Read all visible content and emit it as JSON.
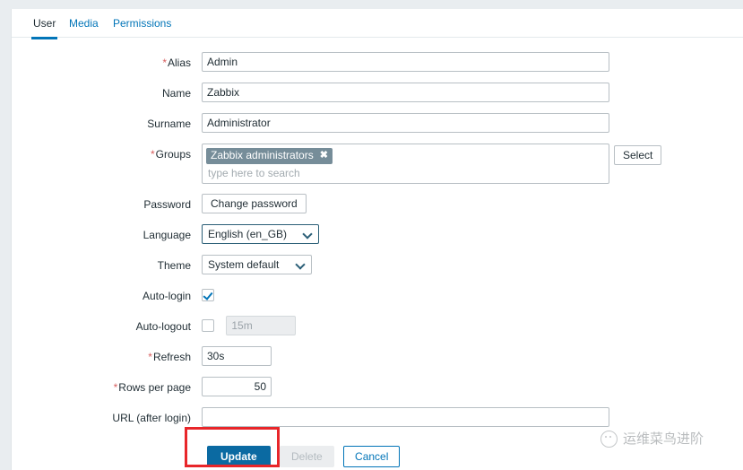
{
  "tabs": [
    {
      "label": "User",
      "active": true
    },
    {
      "label": "Media",
      "active": false
    },
    {
      "label": "Permissions",
      "active": false
    }
  ],
  "form": {
    "alias": {
      "label": "Alias",
      "required": true,
      "value": "Admin"
    },
    "name": {
      "label": "Name",
      "required": false,
      "value": "Zabbix"
    },
    "surname": {
      "label": "Surname",
      "required": false,
      "value": "Administrator"
    },
    "groups": {
      "label": "Groups",
      "required": true,
      "chips": [
        "Zabbix administrators"
      ],
      "placeholder": "type here to search",
      "value": "",
      "select_button": "Select",
      "remove_icon": "✖"
    },
    "password": {
      "label": "Password",
      "required": false,
      "button": "Change password"
    },
    "language": {
      "label": "Language",
      "required": false,
      "value": "English (en_GB)",
      "focused": true
    },
    "theme": {
      "label": "Theme",
      "required": false,
      "value": "System default"
    },
    "auto_login": {
      "label": "Auto-login",
      "required": false,
      "checked": true
    },
    "auto_logout": {
      "label": "Auto-logout",
      "required": false,
      "checked": false,
      "value": "15m",
      "disabled": true
    },
    "refresh": {
      "label": "Refresh",
      "required": true,
      "value": "30s"
    },
    "rows_per_page": {
      "label": "Rows per page",
      "required": true,
      "value": "50"
    },
    "url_after_login": {
      "label": "URL (after login)",
      "required": false,
      "value": "",
      "placeholder": ""
    }
  },
  "footer": {
    "update": "Update",
    "delete": "Delete",
    "cancel": "Cancel"
  },
  "watermark": {
    "text": "运维菜鸟进阶",
    "icon": "wechat-icon"
  },
  "colors": {
    "accent": "#0275b8",
    "primary_button": "#0b6aa2",
    "required_marker": "#d75f5f",
    "chip": "#768d99",
    "highlight": "#e8262a",
    "page_background": "#e9edf0"
  }
}
